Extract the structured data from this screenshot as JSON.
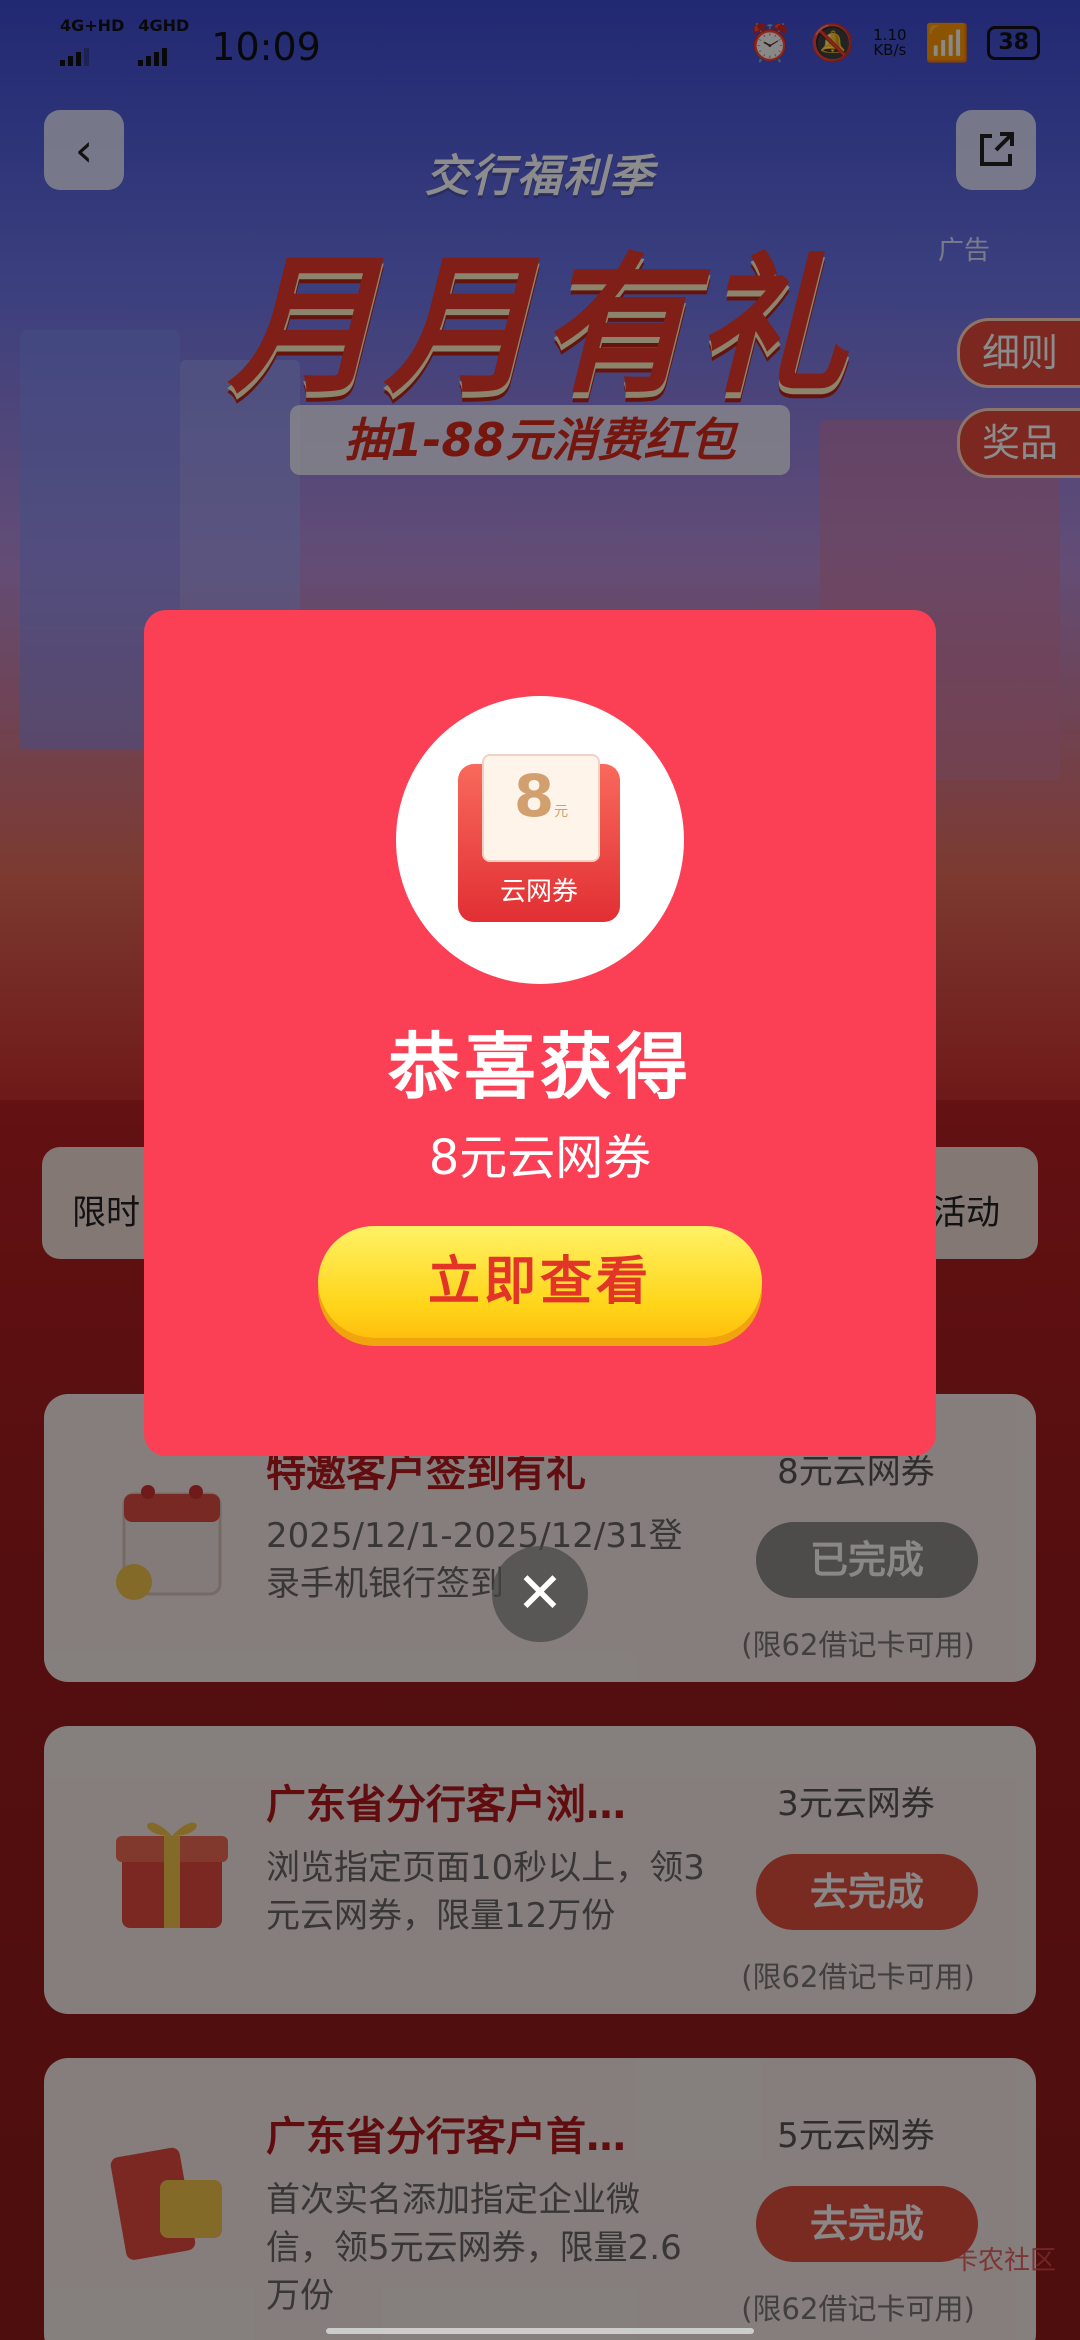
{
  "status_bar": {
    "net1": "4G+HD",
    "net2": "4GHD",
    "time": "10:09",
    "speed_value": "1.10",
    "speed_unit": "KB/s",
    "battery": "38"
  },
  "header": {
    "back_icon": "chevron-left-icon",
    "share_icon": "share-icon",
    "subtitle": "交行福利季",
    "title": "月月有礼",
    "prize_text": "抽1-88元消费红包",
    "ad_label": "广告",
    "rules_tag": "细则",
    "prizes_tag": "奖品"
  },
  "tabs": {
    "left_label": "限时",
    "right_label": "活动"
  },
  "tasks": [
    {
      "title": "特邀客户签到有礼",
      "desc": "2025/12/1-2025/12/31登录手机银行签到",
      "reward": "8元云网券",
      "button": "已完成",
      "limit": "(限62借记卡可用)",
      "icon": "calendar-sign-icon"
    },
    {
      "title": "广东省分行客户浏…",
      "desc": "浏览指定页面10秒以上，领3元云网券，限量12万份",
      "reward": "3元云网券",
      "button": "去完成",
      "limit": "(限62借记卡可用)",
      "icon": "gift-box-icon"
    },
    {
      "title": "广东省分行客户首…",
      "desc": "首次实名添加指定企业微信，领5元云网券，限量2.6万份",
      "reward": "5元云网券",
      "button": "去完成",
      "limit": "(限62借记卡可用)",
      "icon": "card-icon"
    }
  ],
  "modal": {
    "coupon_value": "8",
    "coupon_unit": "元",
    "coupon_label": "云网券",
    "title": "恭喜获得",
    "reward": "8元云网券",
    "button": "立即查看",
    "close_icon": "close-icon"
  },
  "watermark": "卡农社区"
}
